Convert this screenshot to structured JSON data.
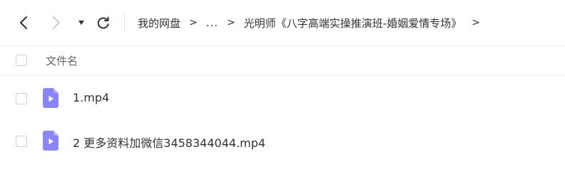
{
  "toolbar": {
    "back_icon": "chevron-left-icon",
    "forward_icon": "chevron-right-icon",
    "history_icon": "caret-down-icon",
    "refresh_icon": "refresh-icon"
  },
  "breadcrumb": {
    "root": "我的网盘",
    "separator": ">",
    "ellipsis": "...",
    "current": "光明师《八字高端实操推演班-婚姻爱情专场》",
    "trailing_separator": ">"
  },
  "file_list": {
    "header": {
      "name_column": "文件名"
    },
    "files": [
      {
        "name": "1.mp4",
        "icon": "video-file-icon"
      },
      {
        "name": "2 更多资料加微信3458344044.mp4",
        "icon": "video-file-icon"
      }
    ]
  },
  "colors": {
    "file_icon": "#8a86f5",
    "file_icon_fold": "#b7b4fa",
    "text": "#333333",
    "muted_text": "#666666",
    "disabled_icon": "#cccccc"
  }
}
